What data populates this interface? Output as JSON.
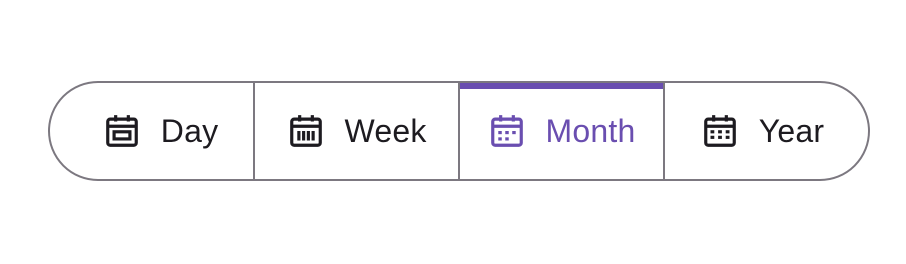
{
  "segmented_control": {
    "selected_index": 2,
    "accent_color": "#6a4eb0",
    "items": [
      {
        "label": "Day",
        "icon": "calendar-day-icon"
      },
      {
        "label": "Week",
        "icon": "calendar-week-icon"
      },
      {
        "label": "Month",
        "icon": "calendar-month-icon"
      },
      {
        "label": "Year",
        "icon": "calendar-year-icon"
      }
    ]
  }
}
